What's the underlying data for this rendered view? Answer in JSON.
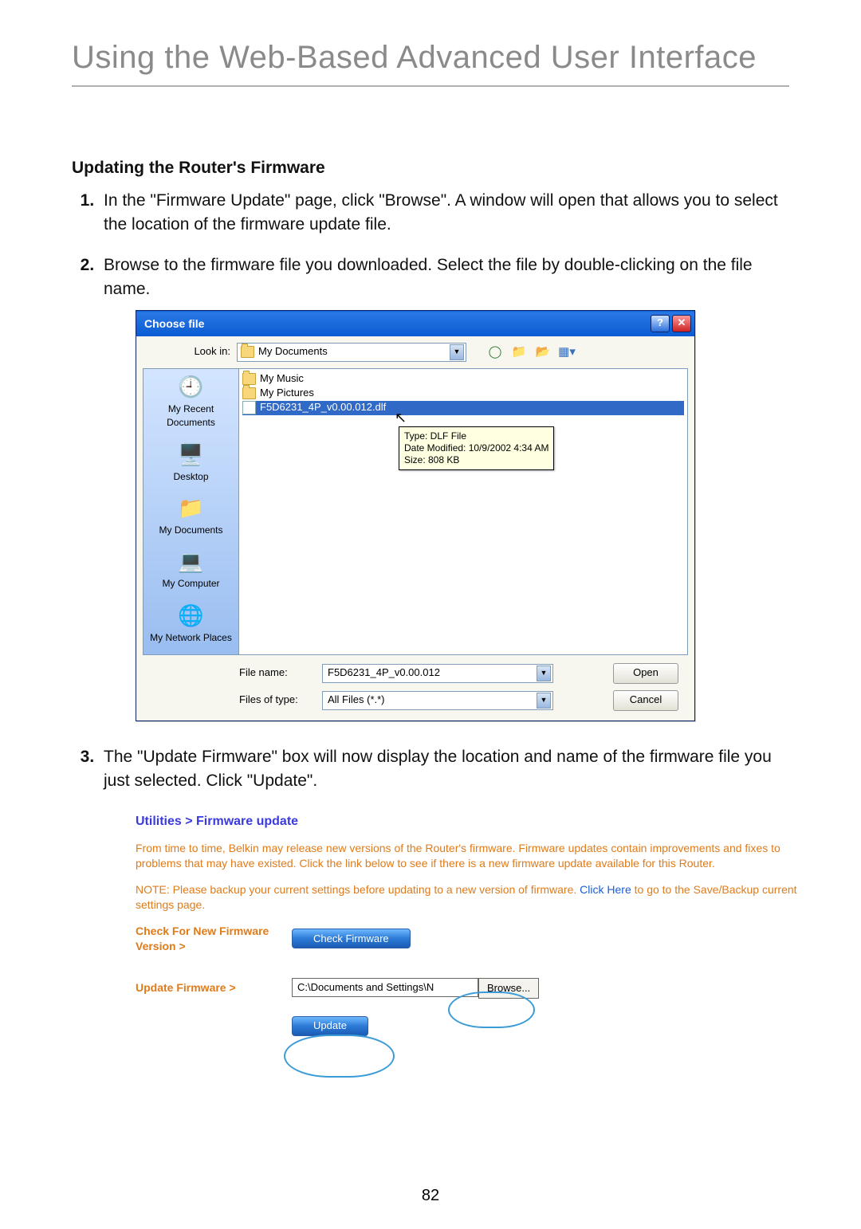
{
  "page_title": "Using the Web-Based Advanced User Interface",
  "section_heading": "Updating the Router's Firmware",
  "steps": {
    "s1": "In the \"Firmware Update\" page, click \"Browse\". A window will open that allows you to select the location of the firmware update file.",
    "s2": "Browse to the firmware file you downloaded. Select the file by double-clicking on the file name.",
    "s3": "The \"Update Firmware\" box will now display the location and name of the firmware file you just selected. Click \"Update\"."
  },
  "file_dialog": {
    "title": "Choose file",
    "look_in_label": "Look in:",
    "look_in_value": "My Documents",
    "sidebar": {
      "recent": "My Recent Documents",
      "desktop": "Desktop",
      "mydocs": "My Documents",
      "mycomp": "My Computer",
      "mynet": "My Network Places"
    },
    "files": {
      "music": "My Music",
      "pictures": "My Pictures",
      "selected": "F5D6231_4P_v0.00.012.dlf"
    },
    "tooltip": {
      "l1": "Type: DLF File",
      "l2": "Date Modified: 10/9/2002 4:34 AM",
      "l3": "Size: 808 KB"
    },
    "file_name_label": "File name:",
    "file_name_value": "F5D6231_4P_v0.00.012",
    "file_type_label": "Files of type:",
    "file_type_value": "All Files (*.*)",
    "open_btn": "Open",
    "cancel_btn": "Cancel"
  },
  "webui": {
    "breadcrumb": "Utilities > Firmware update",
    "p1": "From time to time, Belkin may release new versions of the Router's firmware. Firmware updates contain improvements and fixes to problems that may have existed. Click the link below to see if there is a new firmware update available for this Router.",
    "p2a": "NOTE: Please backup your current settings before updating to a new version of firmware. ",
    "p2_link": "Click Here",
    "p2b": " to go to the Save/Backup current settings page.",
    "check_label": "Check For New Firmware Version >",
    "check_btn": "Check Firmware",
    "update_label": "Update Firmware >",
    "update_path": "C:\\Documents and Settings\\N",
    "browse_btn": "Browse...",
    "update_btn": "Update"
  },
  "page_number": "82"
}
